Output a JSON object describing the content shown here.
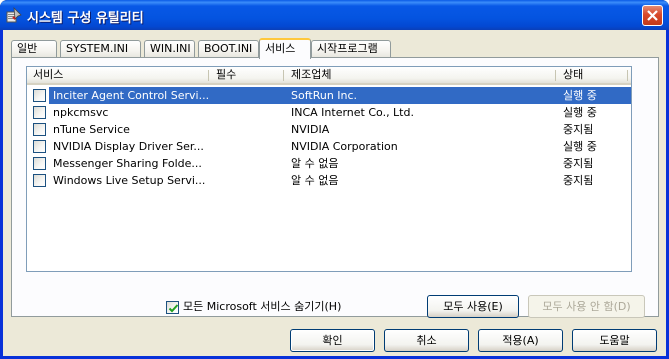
{
  "window": {
    "title": "시스템 구성 유틸리티",
    "colors": {
      "titlebar": "#0454e0",
      "selection": "#316ac5",
      "face": "#ece9d8"
    },
    "app_icon": "msconfig-app-icon",
    "close_icon": "close-x-icon"
  },
  "tabs": [
    {
      "label": "일반"
    },
    {
      "label": "SYSTEM.INI"
    },
    {
      "label": "WIN.INI"
    },
    {
      "label": "BOOT.INI"
    },
    {
      "label": "서비스",
      "active": true
    },
    {
      "label": "시작프로그램"
    }
  ],
  "services": {
    "columns": [
      "서비스",
      "필수",
      "제조업체",
      "상태"
    ],
    "rows": [
      {
        "name": "Inciter Agent Control Servi...",
        "required": "",
        "vendor": "SoftRun Inc.",
        "status": "실행 중",
        "checked": false,
        "selected": true
      },
      {
        "name": "npkcmsvc",
        "required": "",
        "vendor": "INCA Internet Co., Ltd.",
        "status": "실행 중",
        "checked": false,
        "selected": false
      },
      {
        "name": "nTune Service",
        "required": "",
        "vendor": "NVIDIA",
        "status": "중지됨",
        "checked": false,
        "selected": false
      },
      {
        "name": "NVIDIA Display Driver Ser...",
        "required": "",
        "vendor": "NVIDIA Corporation",
        "status": "실행 중",
        "checked": false,
        "selected": false
      },
      {
        "name": "Messenger Sharing Folde...",
        "required": "",
        "vendor": "알 수 없음",
        "status": "중지됨",
        "checked": false,
        "selected": false
      },
      {
        "name": "Windows Live Setup Servi...",
        "required": "",
        "vendor": "알 수 없음",
        "status": "중지됨",
        "checked": false,
        "selected": false
      }
    ]
  },
  "hide_microsoft": {
    "label": "모든 Microsoft 서비스 숨기기(H)",
    "checked": true
  },
  "panel_buttons": {
    "enable_all": "모두 사용(E)",
    "disable_all": "모두 사용 안 함(D)"
  },
  "dialog_buttons": {
    "ok": "확인",
    "cancel": "취소",
    "apply": "적용(A)",
    "help": "도움말"
  }
}
